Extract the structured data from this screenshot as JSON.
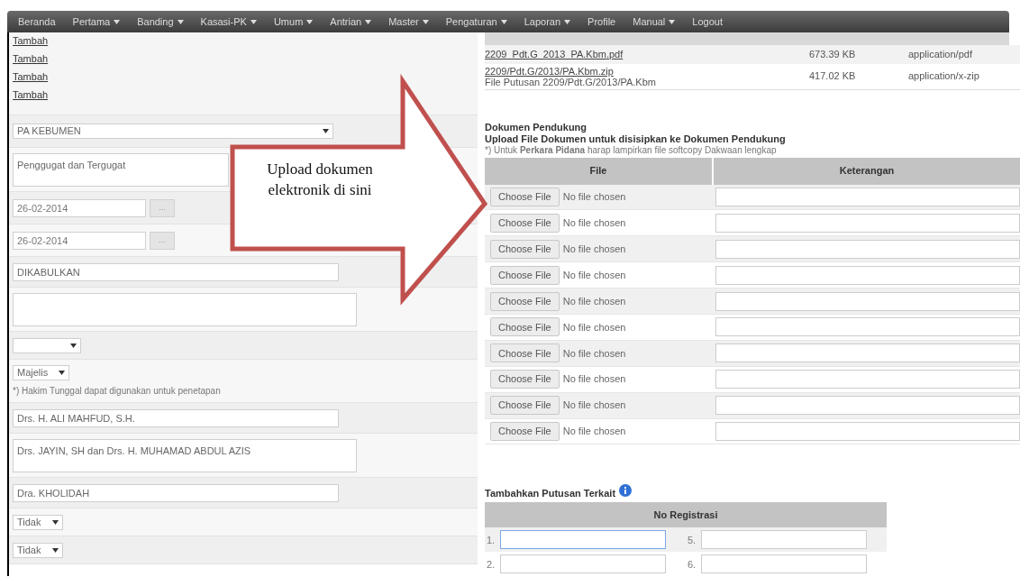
{
  "nav": [
    {
      "label": "Beranda",
      "dropdown": false
    },
    {
      "label": "Pertama",
      "dropdown": true
    },
    {
      "label": "Banding",
      "dropdown": true
    },
    {
      "label": "Kasasi-PK",
      "dropdown": true
    },
    {
      "label": "Umum",
      "dropdown": true
    },
    {
      "label": "Antrian",
      "dropdown": true
    },
    {
      "label": "Master",
      "dropdown": true
    },
    {
      "label": "Pengaturan",
      "dropdown": true
    },
    {
      "label": "Laporan",
      "dropdown": true
    },
    {
      "label": "Profile",
      "dropdown": false
    },
    {
      "label": "Manual",
      "dropdown": true
    },
    {
      "label": "Logout",
      "dropdown": false
    }
  ],
  "links": [
    "Tambah",
    "Tambah",
    "Tambah",
    "Tambah"
  ],
  "fields": [
    {
      "kind": "select-wide",
      "value": "PA KEBUMEN"
    },
    {
      "kind": "textarea",
      "value": "Penggugat dan Tergugat"
    },
    {
      "kind": "date",
      "value": "26-02-2014",
      "button": "..."
    },
    {
      "kind": "date",
      "value": "26-02-2014",
      "button": "..."
    },
    {
      "kind": "input",
      "value": "DIKABULKAN"
    },
    {
      "kind": "textarea"
    },
    {
      "kind": "select"
    },
    {
      "kind": "select",
      "value": "Majelis",
      "note": "*) Hakim Tunggal dapat digunakan untuk penetapan"
    },
    {
      "kind": "input",
      "value": "Drs. H. ALI MAHFUD, S.H."
    },
    {
      "kind": "textarea",
      "value": "Drs. JAYIN, SH dan Drs. H. MUHAMAD ABDUL AZIS"
    },
    {
      "kind": "input",
      "value": "Dra. KHOLIDAH"
    },
    {
      "kind": "select",
      "value": "Tidak"
    },
    {
      "kind": "select",
      "value": "Tidak"
    }
  ],
  "files": [
    {
      "name": "2209_Pdt.G_2013_PA.Kbm.pdf",
      "size": "673.39 KB",
      "type": "application/pdf"
    },
    {
      "name": "2209/Pdt.G/2013/PA.Kbm.zip",
      "description": "File Putusan 2209/Pdt.G/2013/PA.Kbm",
      "size": "417.02 KB",
      "type": "application/x-zip"
    }
  ],
  "documents": {
    "title": "Dokumen Pendukung",
    "subtitle": "Upload File Dokumen untuk disisipkan ke Dokumen Pendukung",
    "note": "*) Untuk **Perkara Pidana** harap lampirkan file softcopy Dakwaan lengkap",
    "columns": [
      "File",
      "Keterangan"
    ],
    "rows": [
      {
        "button": "Choose File",
        "status": "No file chosen"
      },
      {
        "button": "Choose File",
        "status": "No file chosen"
      },
      {
        "button": "Choose File",
        "status": "No file chosen"
      },
      {
        "button": "Choose File",
        "status": "No file chosen"
      },
      {
        "button": "Choose File",
        "status": "No file chosen"
      },
      {
        "button": "Choose File",
        "status": "No file chosen"
      },
      {
        "button": "Choose File",
        "status": "No file chosen"
      },
      {
        "button": "Choose File",
        "status": "No file chosen"
      },
      {
        "button": "Choose File",
        "status": "No file chosen"
      },
      {
        "button": "Choose File",
        "status": "No file chosen"
      }
    ]
  },
  "related": {
    "title": "Tambahkan Putusan Terkait",
    "column": "No Registrasi",
    "rows": [
      [
        {
          "number": "1.",
          "focused": true
        },
        {
          "number": "5.",
          "focused": false
        }
      ],
      [
        {
          "number": "2.",
          "focused": false
        },
        {
          "number": "6.",
          "focused": false
        }
      ]
    ]
  },
  "callout": {
    "text": "Upload dokumen elektronik di sini"
  }
}
